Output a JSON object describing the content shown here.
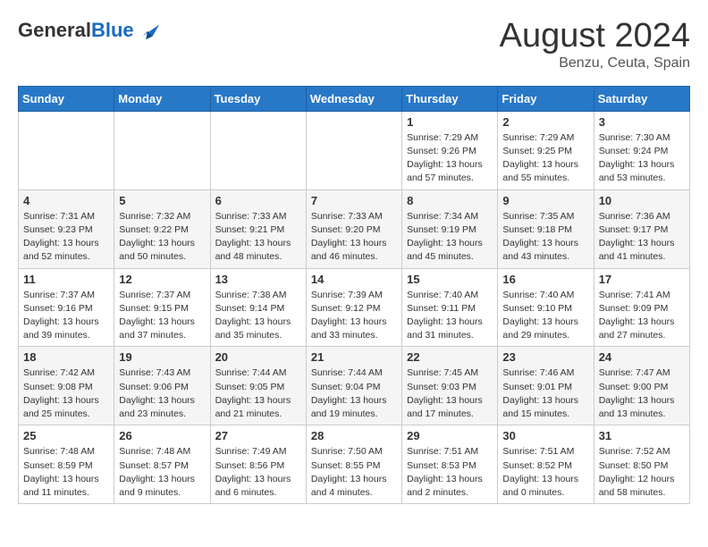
{
  "header": {
    "logo_general": "General",
    "logo_blue": "Blue",
    "month_year": "August 2024",
    "location": "Benzu, Ceuta, Spain"
  },
  "calendar": {
    "days_of_week": [
      "Sunday",
      "Monday",
      "Tuesday",
      "Wednesday",
      "Thursday",
      "Friday",
      "Saturday"
    ],
    "weeks": [
      [
        {
          "day": "",
          "info": ""
        },
        {
          "day": "",
          "info": ""
        },
        {
          "day": "",
          "info": ""
        },
        {
          "day": "",
          "info": ""
        },
        {
          "day": "1",
          "info": "Sunrise: 7:29 AM\nSunset: 9:26 PM\nDaylight: 13 hours and 57 minutes."
        },
        {
          "day": "2",
          "info": "Sunrise: 7:29 AM\nSunset: 9:25 PM\nDaylight: 13 hours and 55 minutes."
        },
        {
          "day": "3",
          "info": "Sunrise: 7:30 AM\nSunset: 9:24 PM\nDaylight: 13 hours and 53 minutes."
        }
      ],
      [
        {
          "day": "4",
          "info": "Sunrise: 7:31 AM\nSunset: 9:23 PM\nDaylight: 13 hours and 52 minutes."
        },
        {
          "day": "5",
          "info": "Sunrise: 7:32 AM\nSunset: 9:22 PM\nDaylight: 13 hours and 50 minutes."
        },
        {
          "day": "6",
          "info": "Sunrise: 7:33 AM\nSunset: 9:21 PM\nDaylight: 13 hours and 48 minutes."
        },
        {
          "day": "7",
          "info": "Sunrise: 7:33 AM\nSunset: 9:20 PM\nDaylight: 13 hours and 46 minutes."
        },
        {
          "day": "8",
          "info": "Sunrise: 7:34 AM\nSunset: 9:19 PM\nDaylight: 13 hours and 45 minutes."
        },
        {
          "day": "9",
          "info": "Sunrise: 7:35 AM\nSunset: 9:18 PM\nDaylight: 13 hours and 43 minutes."
        },
        {
          "day": "10",
          "info": "Sunrise: 7:36 AM\nSunset: 9:17 PM\nDaylight: 13 hours and 41 minutes."
        }
      ],
      [
        {
          "day": "11",
          "info": "Sunrise: 7:37 AM\nSunset: 9:16 PM\nDaylight: 13 hours and 39 minutes."
        },
        {
          "day": "12",
          "info": "Sunrise: 7:37 AM\nSunset: 9:15 PM\nDaylight: 13 hours and 37 minutes."
        },
        {
          "day": "13",
          "info": "Sunrise: 7:38 AM\nSunset: 9:14 PM\nDaylight: 13 hours and 35 minutes."
        },
        {
          "day": "14",
          "info": "Sunrise: 7:39 AM\nSunset: 9:12 PM\nDaylight: 13 hours and 33 minutes."
        },
        {
          "day": "15",
          "info": "Sunrise: 7:40 AM\nSunset: 9:11 PM\nDaylight: 13 hours and 31 minutes."
        },
        {
          "day": "16",
          "info": "Sunrise: 7:40 AM\nSunset: 9:10 PM\nDaylight: 13 hours and 29 minutes."
        },
        {
          "day": "17",
          "info": "Sunrise: 7:41 AM\nSunset: 9:09 PM\nDaylight: 13 hours and 27 minutes."
        }
      ],
      [
        {
          "day": "18",
          "info": "Sunrise: 7:42 AM\nSunset: 9:08 PM\nDaylight: 13 hours and 25 minutes."
        },
        {
          "day": "19",
          "info": "Sunrise: 7:43 AM\nSunset: 9:06 PM\nDaylight: 13 hours and 23 minutes."
        },
        {
          "day": "20",
          "info": "Sunrise: 7:44 AM\nSunset: 9:05 PM\nDaylight: 13 hours and 21 minutes."
        },
        {
          "day": "21",
          "info": "Sunrise: 7:44 AM\nSunset: 9:04 PM\nDaylight: 13 hours and 19 minutes."
        },
        {
          "day": "22",
          "info": "Sunrise: 7:45 AM\nSunset: 9:03 PM\nDaylight: 13 hours and 17 minutes."
        },
        {
          "day": "23",
          "info": "Sunrise: 7:46 AM\nSunset: 9:01 PM\nDaylight: 13 hours and 15 minutes."
        },
        {
          "day": "24",
          "info": "Sunrise: 7:47 AM\nSunset: 9:00 PM\nDaylight: 13 hours and 13 minutes."
        }
      ],
      [
        {
          "day": "25",
          "info": "Sunrise: 7:48 AM\nSunset: 8:59 PM\nDaylight: 13 hours and 11 minutes."
        },
        {
          "day": "26",
          "info": "Sunrise: 7:48 AM\nSunset: 8:57 PM\nDaylight: 13 hours and 9 minutes."
        },
        {
          "day": "27",
          "info": "Sunrise: 7:49 AM\nSunset: 8:56 PM\nDaylight: 13 hours and 6 minutes."
        },
        {
          "day": "28",
          "info": "Sunrise: 7:50 AM\nSunset: 8:55 PM\nDaylight: 13 hours and 4 minutes."
        },
        {
          "day": "29",
          "info": "Sunrise: 7:51 AM\nSunset: 8:53 PM\nDaylight: 13 hours and 2 minutes."
        },
        {
          "day": "30",
          "info": "Sunrise: 7:51 AM\nSunset: 8:52 PM\nDaylight: 13 hours and 0 minutes."
        },
        {
          "day": "31",
          "info": "Sunrise: 7:52 AM\nSunset: 8:50 PM\nDaylight: 12 hours and 58 minutes."
        }
      ]
    ]
  }
}
